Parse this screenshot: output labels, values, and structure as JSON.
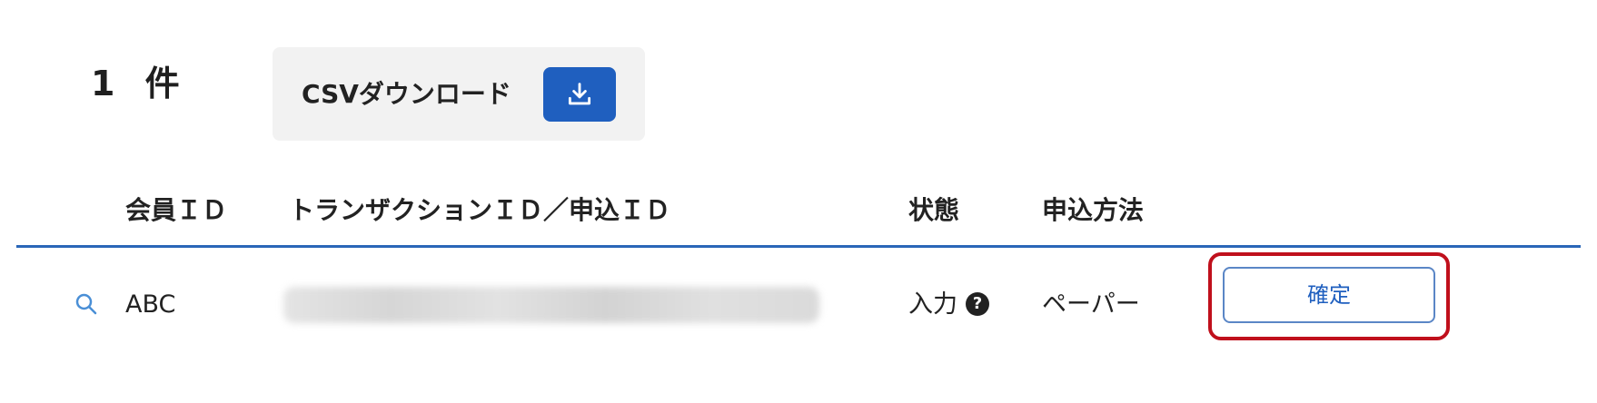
{
  "summary": {
    "count_text": "1 件"
  },
  "csv": {
    "label": "CSVダウンロード",
    "icon": "download-icon",
    "button_color": "#1f5fbf"
  },
  "table": {
    "headers": {
      "member_id": "会員ＩＤ",
      "transaction_id": "トランザクションＩＤ／申込ＩＤ",
      "status": "状態",
      "method": "申込方法"
    },
    "rule_color": "#2a66b8",
    "rows": [
      {
        "icon": "search-icon",
        "member_id": "ABC",
        "transaction_id_redacted": true,
        "status": "入力",
        "status_help_icon": "question-circle-icon",
        "method": "ペーパー",
        "action_label": "確定"
      }
    ]
  },
  "highlight_color": "#c0101c"
}
